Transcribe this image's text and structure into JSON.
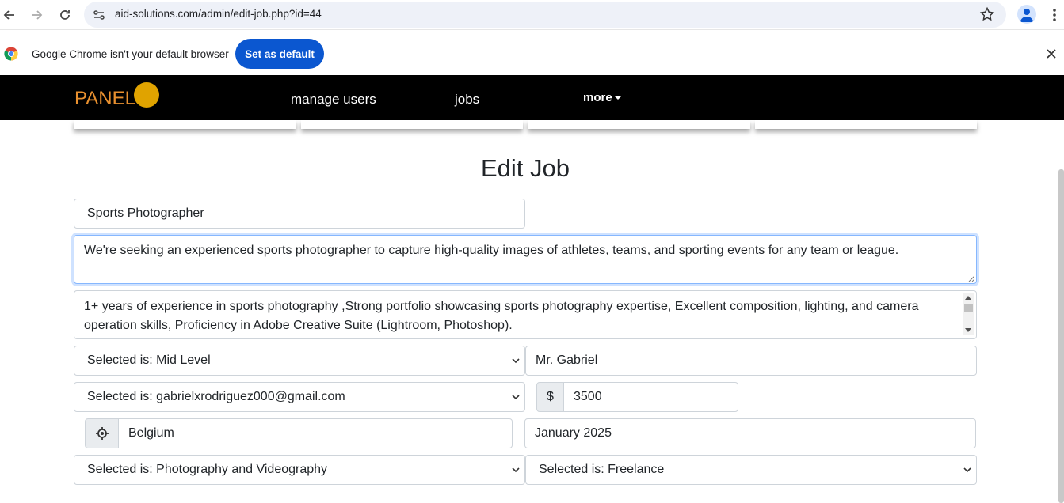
{
  "browser": {
    "url": "aid-solutions.com/admin/edit-job.php?id=44",
    "infobar_message": "Google Chrome isn't your default browser",
    "set_default_label": "Set as default"
  },
  "navbar": {
    "brand": "PANEL",
    "links": [
      "manage users",
      "jobs"
    ],
    "more_label": "more",
    "brand_color": "#e8902f",
    "dot_color": "#e0a300"
  },
  "page": {
    "title": "Edit Job"
  },
  "form": {
    "job_title": "Sports Photographer",
    "description": "We're seeking an experienced sports photographer to capture high-quality images of athletes, teams, and sporting events for any team or league.",
    "requirements": "1+ years of experience in sports photography ,Strong portfolio showcasing sports photography expertise, Excellent composition, lighting, and camera operation skills, Proficiency in Adobe Creative Suite (Lightroom, Photoshop).",
    "level_select": "Selected is: Mid Level",
    "contact_name": "Mr. Gabriel",
    "email_select": "Selected is: gabrielxrodriguez000@gmail.com",
    "currency_symbol": "$",
    "salary": "3500",
    "location": "Belgium",
    "date": "January 2025",
    "category_select": "Selected is: Photography and Videography",
    "type_select": "Selected is: Freelance"
  }
}
